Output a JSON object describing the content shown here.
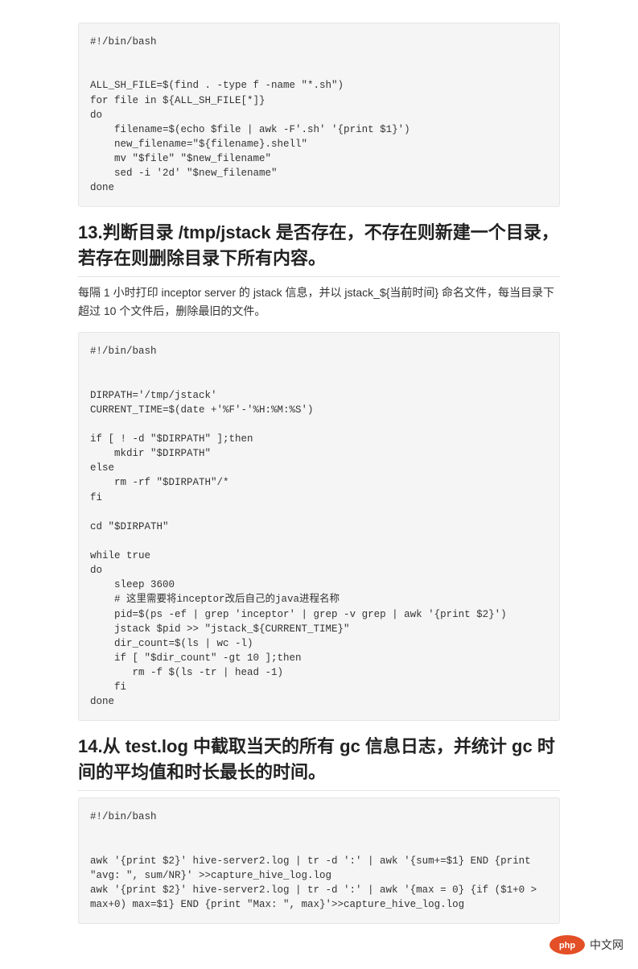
{
  "code1": "#!/bin/bash\n\n\nALL_SH_FILE=$(find . -type f -name \"*.sh\")\nfor file in ${ALL_SH_FILE[*]}\ndo\n    filename=$(echo $file | awk -F'.sh' '{print $1}')\n    new_filename=\"${filename}.shell\"\n    mv \"$file\" \"$new_filename\"\n    sed -i '2d' \"$new_filename\"\ndone",
  "heading13": "13.判断目录 /tmp/jstack 是否存在，不存在则新建一个目录，若存在则删除目录下所有内容。",
  "desc13": "每隔 1 小时打印 inceptor server 的 jstack 信息，并以 jstack_${当前时间} 命名文件，每当目录下超过 10 个文件后，删除最旧的文件。",
  "code2": "#!/bin/bash\n\n\nDIRPATH='/tmp/jstack'\nCURRENT_TIME=$(date +'%F'-'%H:%M:%S')\n\nif [ ! -d \"$DIRPATH\" ];then\n    mkdir \"$DIRPATH\"\nelse\n    rm -rf \"$DIRPATH\"/*\nfi\n\ncd \"$DIRPATH\"\n\nwhile true\ndo\n    sleep 3600\n    # 这里需要将inceptor改后自己的java进程名称\n    pid=$(ps -ef | grep 'inceptor' | grep -v grep | awk '{print $2}')\n    jstack $pid >> \"jstack_${CURRENT_TIME}\"\n    dir_count=$(ls | wc -l)\n    if [ \"$dir_count\" -gt 10 ];then\n       rm -f $(ls -tr | head -1)\n    fi\ndone",
  "heading14": "14.从 test.log 中截取当天的所有 gc 信息日志，并统计 gc 时间的平均值和时长最长的时间。",
  "code3": "#!/bin/bash\n\n\nawk '{print $2}' hive-server2.log | tr -d ':' | awk '{sum+=$1} END {print \"avg: \", sum/NR}' >>capture_hive_log.log\nawk '{print $2}' hive-server2.log | tr -d ':' | awk '{max = 0} {if ($1+0 > max+0) max=$1} END {print \"Max: \", max}'>>capture_hive_log.log",
  "watermark": {
    "badge_text": "php",
    "text": "中文网"
  }
}
